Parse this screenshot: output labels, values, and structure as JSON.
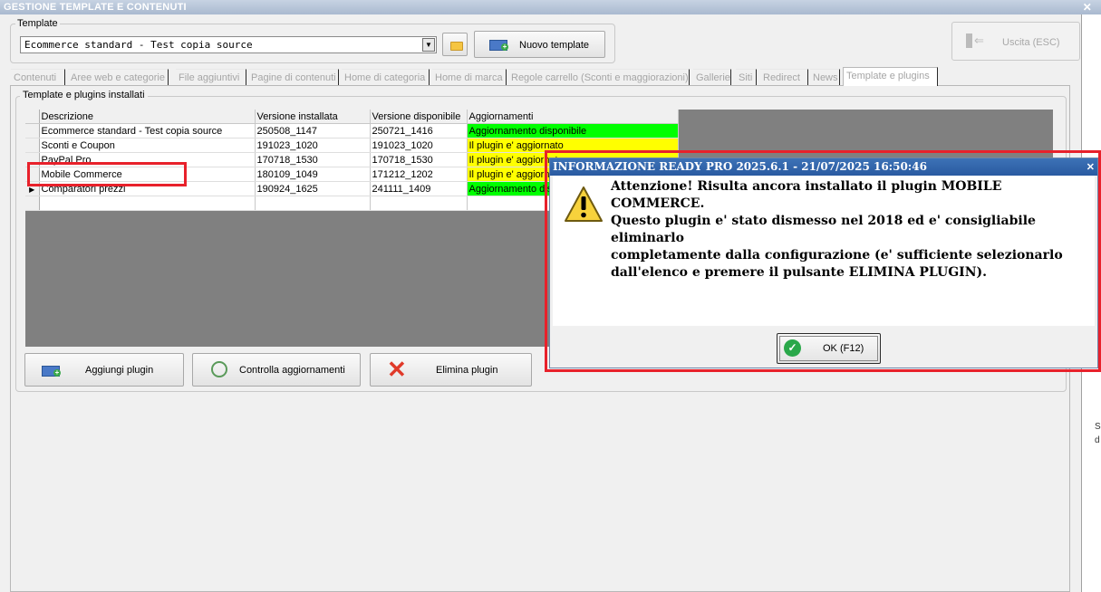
{
  "window": {
    "title": "GESTIONE TEMPLATE E CONTENUTI",
    "close_glyph": "✕"
  },
  "template": {
    "group_label": "Template",
    "selected": "Ecommerce standard - Test copia source",
    "new_template_label": "Nuovo template",
    "exit_label": "Uscita (ESC)"
  },
  "tabs": [
    "Contenuti",
    "Aree web e categorie",
    "File aggiuntivi",
    "Pagine di contenuti",
    "Home di categoria",
    "Home di marca",
    "Regole carrello (Sconti e maggiorazioni)",
    "Gallerie",
    "Siti",
    "Redirect",
    "News",
    "Template e plugins"
  ],
  "plugins": {
    "group_label": "Template e plugins installati",
    "columns": [
      "Descrizione",
      "Versione installata",
      "Versione disponibile",
      "Aggiornamenti"
    ],
    "rows": [
      {
        "desc": "Ecommerce standard - Test copia source",
        "installed": "250508_1147",
        "available": "250721_1416",
        "status": "Aggiornamento disponibile",
        "status_color": "#00ff00"
      },
      {
        "desc": "Sconti e Coupon",
        "installed": "191023_1020",
        "available": "191023_1020",
        "status": "Il plugin e' aggiornato",
        "status_color": "#ffff00"
      },
      {
        "desc": "PayPal Pro",
        "installed": "170718_1530",
        "available": "170718_1530",
        "status": "Il plugin e' aggiornato",
        "status_color": "#ffff00"
      },
      {
        "desc": "Mobile Commerce",
        "installed": "180109_1049",
        "available": "171212_1202",
        "status": "Il plugin e' aggiornato",
        "status_color": "#ffff00"
      },
      {
        "desc": "Comparatori prezzi",
        "installed": "190924_1625",
        "available": "241111_1409",
        "status": "Aggiornamento disponibile",
        "status_color": "#00ff00"
      }
    ],
    "add_label": "Aggiungi plugin",
    "check_label": "Controlla aggiornamenti",
    "delete_label": "Elimina plugin"
  },
  "side_strip": {
    "line1": "S",
    "line2": "d"
  },
  "dialog": {
    "title": "INFORMAZIONE READY PRO 2025.6.1 - 21/07/2025 16:50:46",
    "message": "Attenzione! Risulta ancora installato il plugin MOBILE COMMERCE.\nQuesto plugin e' stato dismesso nel 2018 ed e' consigliabile eliminarlo\ncompletamente dalla configurazione (e' sufficiente selezionarlo\ndall'elenco e premere il pulsante ELIMINA PLUGIN).",
    "ok_label": "OK (F12)",
    "close_glyph": "✕"
  }
}
